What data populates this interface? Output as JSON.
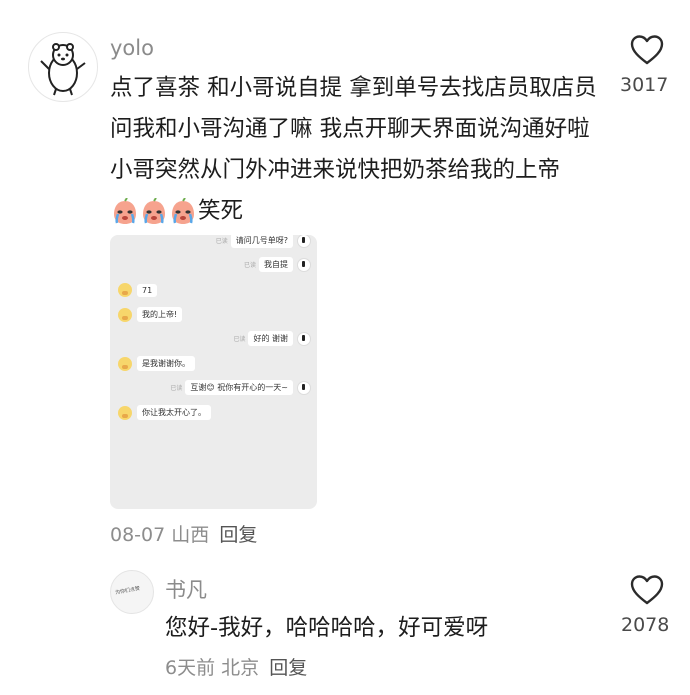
{
  "comment": {
    "username": "yolo",
    "text_part1": "点了喜茶 和小哥说自提 拿到单号去找店员取店员问我和小哥沟通了嘛 我点开聊天界面说沟通好啦 小哥突然从门外冲进来说快把奶茶给我的上帝",
    "emoji_name": "crying-peach-emoji",
    "text_part2": "笑死",
    "like_count": "3017",
    "date": "08-07",
    "location": "山西",
    "reply_label": "回复",
    "chat_image": {
      "messages": [
        {
          "side": "right",
          "text": "请问几号单呀?",
          "status": "已读"
        },
        {
          "side": "right",
          "text": "我自提",
          "status": "已读"
        },
        {
          "side": "left",
          "text": "71"
        },
        {
          "side": "left",
          "text": "我的上帝!"
        },
        {
          "side": "right",
          "text": "好的 谢谢",
          "status": "已读"
        },
        {
          "side": "left",
          "text": "是我谢谢你。"
        },
        {
          "side": "right",
          "text": "互谢😊 祝你有开心的一天~",
          "status": "已读"
        },
        {
          "side": "left",
          "text": "你让我太开心了。"
        }
      ]
    }
  },
  "reply": {
    "username": "书凡",
    "avatar_text": "为你们点赞",
    "text": "您好-我好，哈哈哈哈，好可爱呀",
    "like_count": "2078",
    "date": "6天前",
    "location": "北京",
    "reply_label": "回复"
  }
}
